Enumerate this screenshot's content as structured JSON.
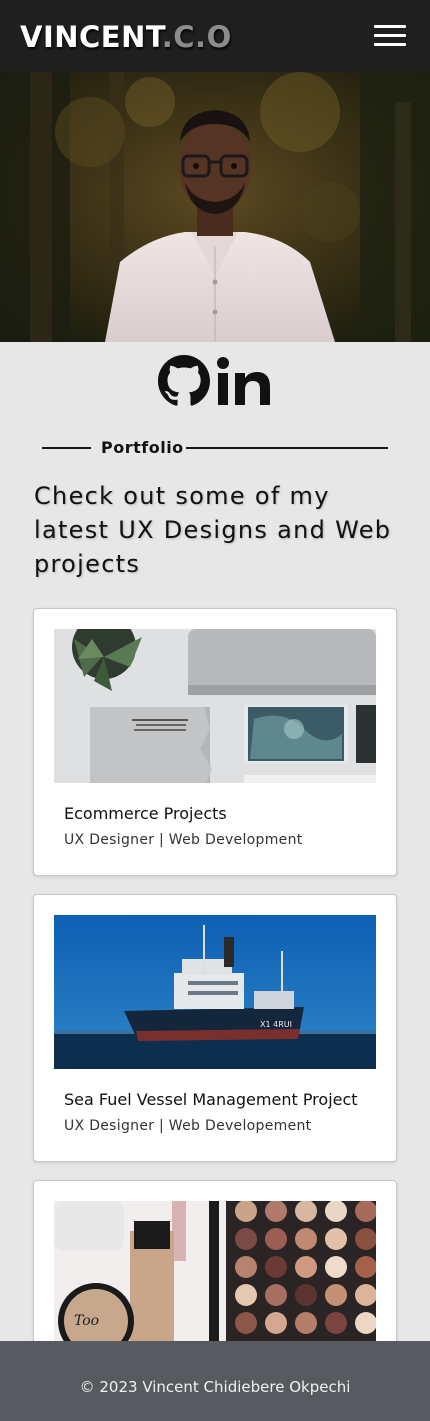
{
  "navbar": {
    "brand_main": "VINCENT",
    "brand_suffix": ".C.O",
    "menu_icon": "hamburger-menu-icon"
  },
  "hero": {
    "image": "portrait-photo"
  },
  "social": {
    "github_icon": "github-icon",
    "linkedin_icon": "linkedin-icon",
    "linkedin_text": "in"
  },
  "portfolio": {
    "section_label": "Portfolio",
    "intro": "Check out some of my latest UX Designs and Web projects",
    "projects": [
      {
        "title": "Ecommerce Projects",
        "subtitle": "UX Designer | Web Development",
        "image": "desk-workspace-photo"
      },
      {
        "title": "Sea Fuel Vessel Management Project",
        "subtitle": "UX Designer | Web Developement",
        "image": "ship-at-sea-photo"
      },
      {
        "title": "",
        "subtitle": "",
        "image": "cosmetics-photo"
      }
    ]
  },
  "footer": {
    "copyright": "© 2023 Vincent Chidiebere Okpechi"
  },
  "colors": {
    "navbar_bg": "#1f1f1f",
    "page_bg": "#e7e7e7",
    "footer_bg": "#575a5e",
    "brand_suffix": "#8c8c8c"
  }
}
